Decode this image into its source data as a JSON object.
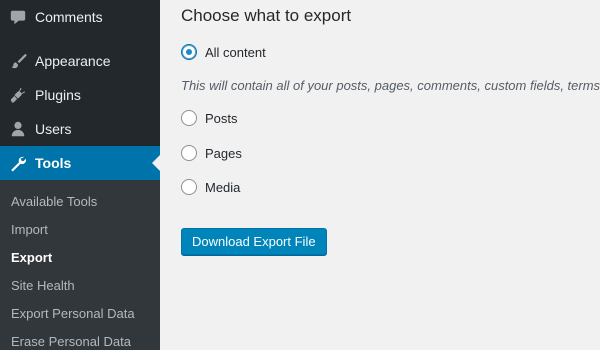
{
  "sidebar": {
    "menu": [
      {
        "label": "Comments",
        "icon": "comment-icon"
      },
      {
        "label": "Appearance",
        "icon": "paintbrush-icon"
      },
      {
        "label": "Plugins",
        "icon": "plugin-icon"
      },
      {
        "label": "Users",
        "icon": "user-icon"
      },
      {
        "label": "Tools",
        "icon": "wrench-icon"
      }
    ],
    "submenu": [
      "Available Tools",
      "Import",
      "Export",
      "Site Health",
      "Export Personal Data",
      "Erase Personal Data"
    ],
    "active_submenu": "Export"
  },
  "main": {
    "heading": "Choose what to export",
    "options": [
      {
        "label": "All content",
        "checked": true
      },
      {
        "label": "Posts",
        "checked": false
      },
      {
        "label": "Pages",
        "checked": false
      },
      {
        "label": "Media",
        "checked": false
      }
    ],
    "description": "This will contain all of your posts, pages, comments, custom fields, terms, navigation menus, and custom posts.",
    "download_button": "Download Export File"
  },
  "colors": {
    "sidebar_bg": "#23282d",
    "submenu_bg": "#32373c",
    "accent": "#0073aa",
    "button": "#0085ba",
    "content_bg": "#f1f1f1"
  }
}
